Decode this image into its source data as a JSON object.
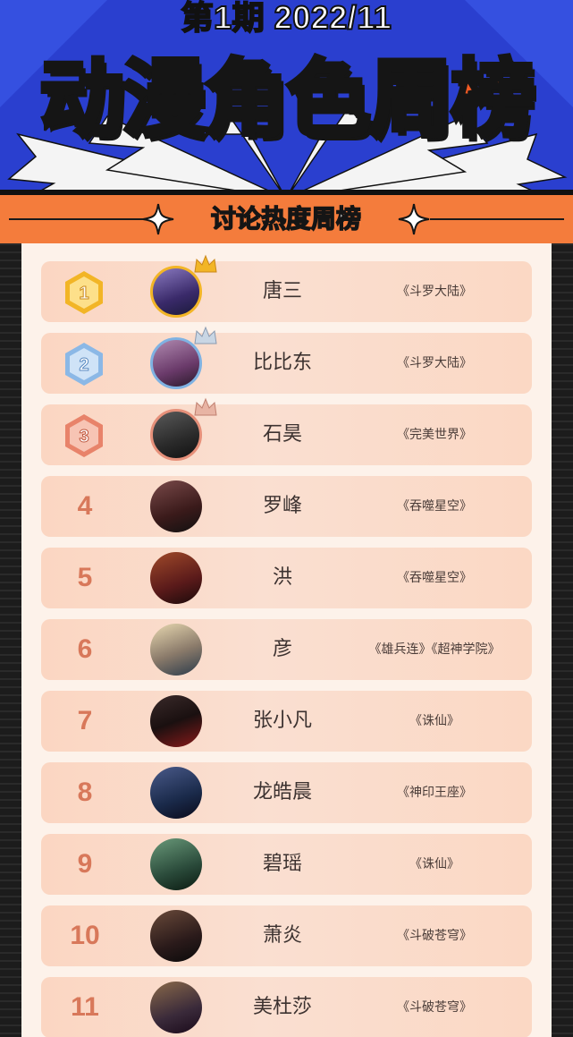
{
  "header": {
    "issue": "第1期 2022/11",
    "title": "动漫角色周榜",
    "subtitle": "讨论热度周榜"
  },
  "colors": {
    "header_blue": "#2a3fcf",
    "accent_orange": "#f25a24",
    "band_orange": "#f47c3c",
    "row_bg": "#fbd6c2",
    "rank_text": "#d8785a",
    "gold": "#f2b526",
    "silver": "#7fb2e2",
    "bronze": "#e6907a"
  },
  "ranking": [
    {
      "rank": "1",
      "medal": "gold-medal-icon",
      "name": "唐三",
      "work": "《斗罗大陆》",
      "avatar_color": "#5a4a8a"
    },
    {
      "rank": "2",
      "medal": "silver-medal-icon",
      "name": "比比东",
      "work": "《斗罗大陆》",
      "avatar_color": "#6a4a7a"
    },
    {
      "rank": "3",
      "medal": "bronze-medal-icon",
      "name": "石昊",
      "work": "《完美世界》",
      "avatar_color": "#3a3a3a"
    },
    {
      "rank": "4",
      "name": "罗峰",
      "work": "《吞噬星空》",
      "avatar_color": "#4a2a2a"
    },
    {
      "rank": "5",
      "name": "洪",
      "work": "《吞噬星空》",
      "avatar_color": "#6a2a1a"
    },
    {
      "rank": "6",
      "name": "彦",
      "work": "《雄兵连》《超神学院》",
      "avatar_color": "#8a8a6a"
    },
    {
      "rank": "7",
      "name": "张小凡",
      "work": "《诛仙》",
      "avatar_color": "#3a2a2a"
    },
    {
      "rank": "8",
      "name": "龙皓晨",
      "work": "《神印王座》",
      "avatar_color": "#2a3a5a"
    },
    {
      "rank": "9",
      "name": "碧瑶",
      "work": "《诛仙》",
      "avatar_color": "#2a5a3a"
    },
    {
      "rank": "10",
      "name": "萧炎",
      "work": "《斗破苍穹》",
      "avatar_color": "#3a2a2a"
    },
    {
      "rank": "11",
      "name": "美杜莎",
      "work": "《斗破苍穹》",
      "avatar_color": "#4a3a4a"
    }
  ]
}
